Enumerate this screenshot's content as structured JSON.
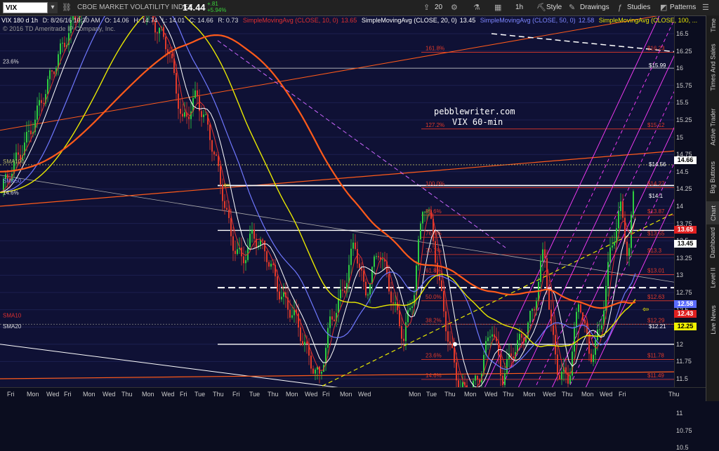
{
  "toolbar": {
    "symbol": "VIX",
    "title": "CBOE MARKET VOLATILITY INDEX",
    "price": "14.44",
    "change": "+.81",
    "change_pct": "+5.94%",
    "share_count": "20",
    "interval": "1h",
    "style_label": "Style",
    "drawings_label": "Drawings",
    "studies_label": "Studies",
    "patterns_label": "Patterns"
  },
  "info": {
    "desc": "VIX 180 d 1h",
    "date": "D: 8/26/16 10:30 AM",
    "open": "O: 14.06",
    "high": "H: 14.74",
    "low": "L: 14.01",
    "close": "C: 14.66",
    "range": "R: 0.73",
    "sma10": "SimpleMovingAvg (CLOSE, 10, 0)",
    "sma10_val": "13.65",
    "sma20": "SimpleMovingAvg (CLOSE, 20, 0)",
    "sma20_val": "13.45",
    "sma50": "SimpleMovingAvg (CLOSE, 50, 0)",
    "sma50_val": "12.58",
    "sma100": "SimpleMovingAvg (CLOSE, 100, ..."
  },
  "copyright": "© 2016 TD Ameritrade IP Company, Inc.",
  "watermark": {
    "line1": "pebblewriter.com",
    "line2": "VIX 60-min"
  },
  "chart_labels": {
    "fib_left_236": "23.6%",
    "fib_left_146": "14.6%",
    "fib_left_0": "0.0%",
    "sma100": "SMA100",
    "sma50": "SMA50",
    "sma10": "SMA10",
    "sma20": "SMA20"
  },
  "fib_right": [
    {
      "pct": "161.8%",
      "val": "$16.23"
    },
    {
      "pct": "127.2%",
      "val": "$15.12"
    },
    {
      "pct": "100.0%",
      "val": "$14.27"
    },
    {
      "pct": "88.6%",
      "val": "$13.87"
    },
    {
      "pct": "76.4%",
      "val": "$13.55"
    },
    {
      "pct": "70.7%",
      "val": "$13.3"
    },
    {
      "pct": "61.8%",
      "val": "$13.01"
    },
    {
      "pct": "50.0%",
      "val": "$12.63"
    },
    {
      "pct": "38.2%",
      "val": "$12.29"
    },
    {
      "pct": "23.6%",
      "val": "$11.78"
    },
    {
      "pct": "14.6%",
      "val": "$11.49"
    },
    {
      "pct": "0.0%",
      "val": "$11.02"
    }
  ],
  "price_labels": [
    "$15.99",
    "$14.56",
    "$14.1",
    "$12.21"
  ],
  "badges": [
    {
      "val": "14.66",
      "bg": "#ffffff",
      "fg": "#000000"
    },
    {
      "val": "13.65",
      "bg": "#e02020",
      "fg": "#ffffff"
    },
    {
      "val": "13.45",
      "bg": "#ffffff",
      "fg": "#000000"
    },
    {
      "val": "12.58",
      "bg": "#5b6cff",
      "fg": "#ffffff"
    },
    {
      "val": "12.43",
      "bg": "#e02020",
      "fg": "#ffffff"
    },
    {
      "val": "12.25",
      "bg": "#f0f000",
      "fg": "#000000"
    }
  ],
  "y_ticks": [
    "16.5",
    "16.25",
    "16",
    "15.75",
    "15.5",
    "15.25",
    "15",
    "14.75",
    "14.5",
    "14.25",
    "14",
    "13.75",
    "13.5",
    "13.25",
    "13",
    "12.75",
    "12.5",
    "12.25",
    "12",
    "11.75",
    "11.5",
    "11.25",
    "11",
    "10.75",
    "10.5"
  ],
  "x_ticks": [
    "Fri",
    "Mon",
    "Wed",
    "Fri",
    "Mon",
    "Wed",
    "Thu",
    "Mon",
    "Wed",
    "Fri",
    "Tue",
    "Thu",
    "Fri",
    "Tue",
    "Thu",
    "Mon",
    "Wed",
    "Fri",
    "Mon",
    "Wed",
    "Mon",
    "Tue",
    "Thu",
    "Mon",
    "Wed",
    "Thu",
    "Mon",
    "Wed",
    "Thu",
    "Mon",
    "Wed",
    "Fri",
    "Thu"
  ],
  "side_tabs": [
    "Time",
    "Times And Sales",
    "Active Trader",
    "Big Buttons",
    "Chart",
    "Dashboard",
    "Level II",
    "Live News"
  ],
  "colors": {
    "background": "#0f1135",
    "fib": "#e23a2a",
    "sma10": "#e03030",
    "sma20": "#ffffff",
    "sma50": "#6f78ff",
    "sma100": "#e8e800",
    "sma200": "#ff5a1a",
    "channel": "#ff3dff",
    "candle_up": "#2ecc40",
    "candle_down": "#e23a2a"
  }
}
